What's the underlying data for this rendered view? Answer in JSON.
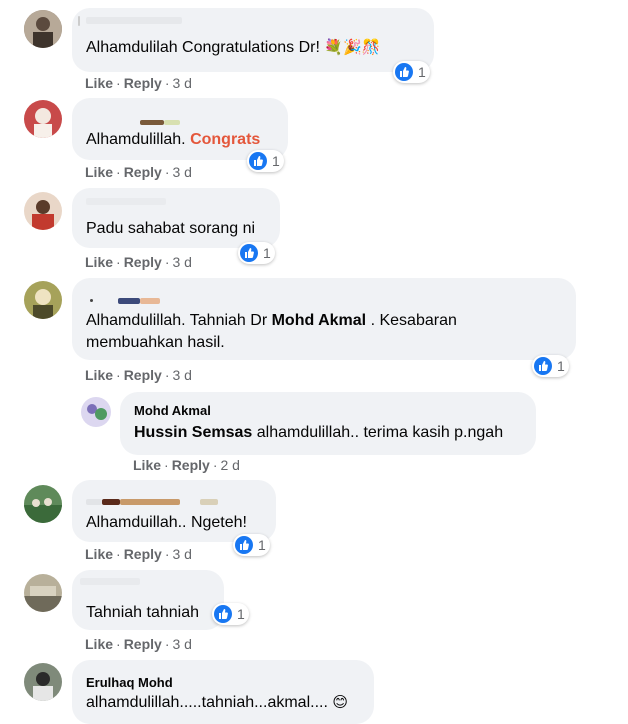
{
  "comments": [
    {
      "text": "Alhamdulilah Congratulations Dr!",
      "emoji": "💐🎉🎊",
      "actions": {
        "like": "Like",
        "reply": "Reply",
        "time": "3 d"
      },
      "reactions": "1"
    },
    {
      "text_prefix": "Alhamdulillah.",
      "text_highlight": "Congrats",
      "actions": {
        "like": "Like",
        "reply": "Reply",
        "time": "3 d"
      },
      "reactions": "1"
    },
    {
      "text": "Padu sahabat sorang ni",
      "actions": {
        "like": "Like",
        "reply": "Reply",
        "time": "3 d"
      },
      "reactions": "1"
    },
    {
      "line1_prefix": "Alhamdulillah. Tahniah Dr",
      "line1_tag": "Mohd Akmal",
      "line1_suffix": ". Kesabaran",
      "line2": "membuahkan hasil.",
      "actions": {
        "like": "Like",
        "reply": "Reply",
        "time": "3 d"
      },
      "reactions": "1"
    },
    {
      "author": "Mohd Akmal",
      "mention": "Hussin Semsas",
      "text": "alhamdulillah.. terima kasih p.ngah",
      "actions": {
        "like": "Like",
        "reply": "Reply",
        "time": "2 d"
      }
    },
    {
      "text": "Alhamduillah.. Ngeteh!",
      "actions": {
        "like": "Like",
        "reply": "Reply",
        "time": "3 d"
      },
      "reactions": "1"
    },
    {
      "text": "Tahniah tahniah",
      "actions": {
        "like": "Like",
        "reply": "Reply",
        "time": "3 d"
      },
      "reactions": "1"
    },
    {
      "author": "Erulhaq Mohd",
      "text": "alhamdulillah.....tahniah...akmal....",
      "emoji": "😊"
    }
  ],
  "colors": {
    "bubble": "#f0f2f5",
    "like_blue": "#1877f2",
    "meta_gray": "#65676b",
    "congrats": "#e4573b"
  },
  "icons": {
    "like": "thumbs-up-icon"
  }
}
